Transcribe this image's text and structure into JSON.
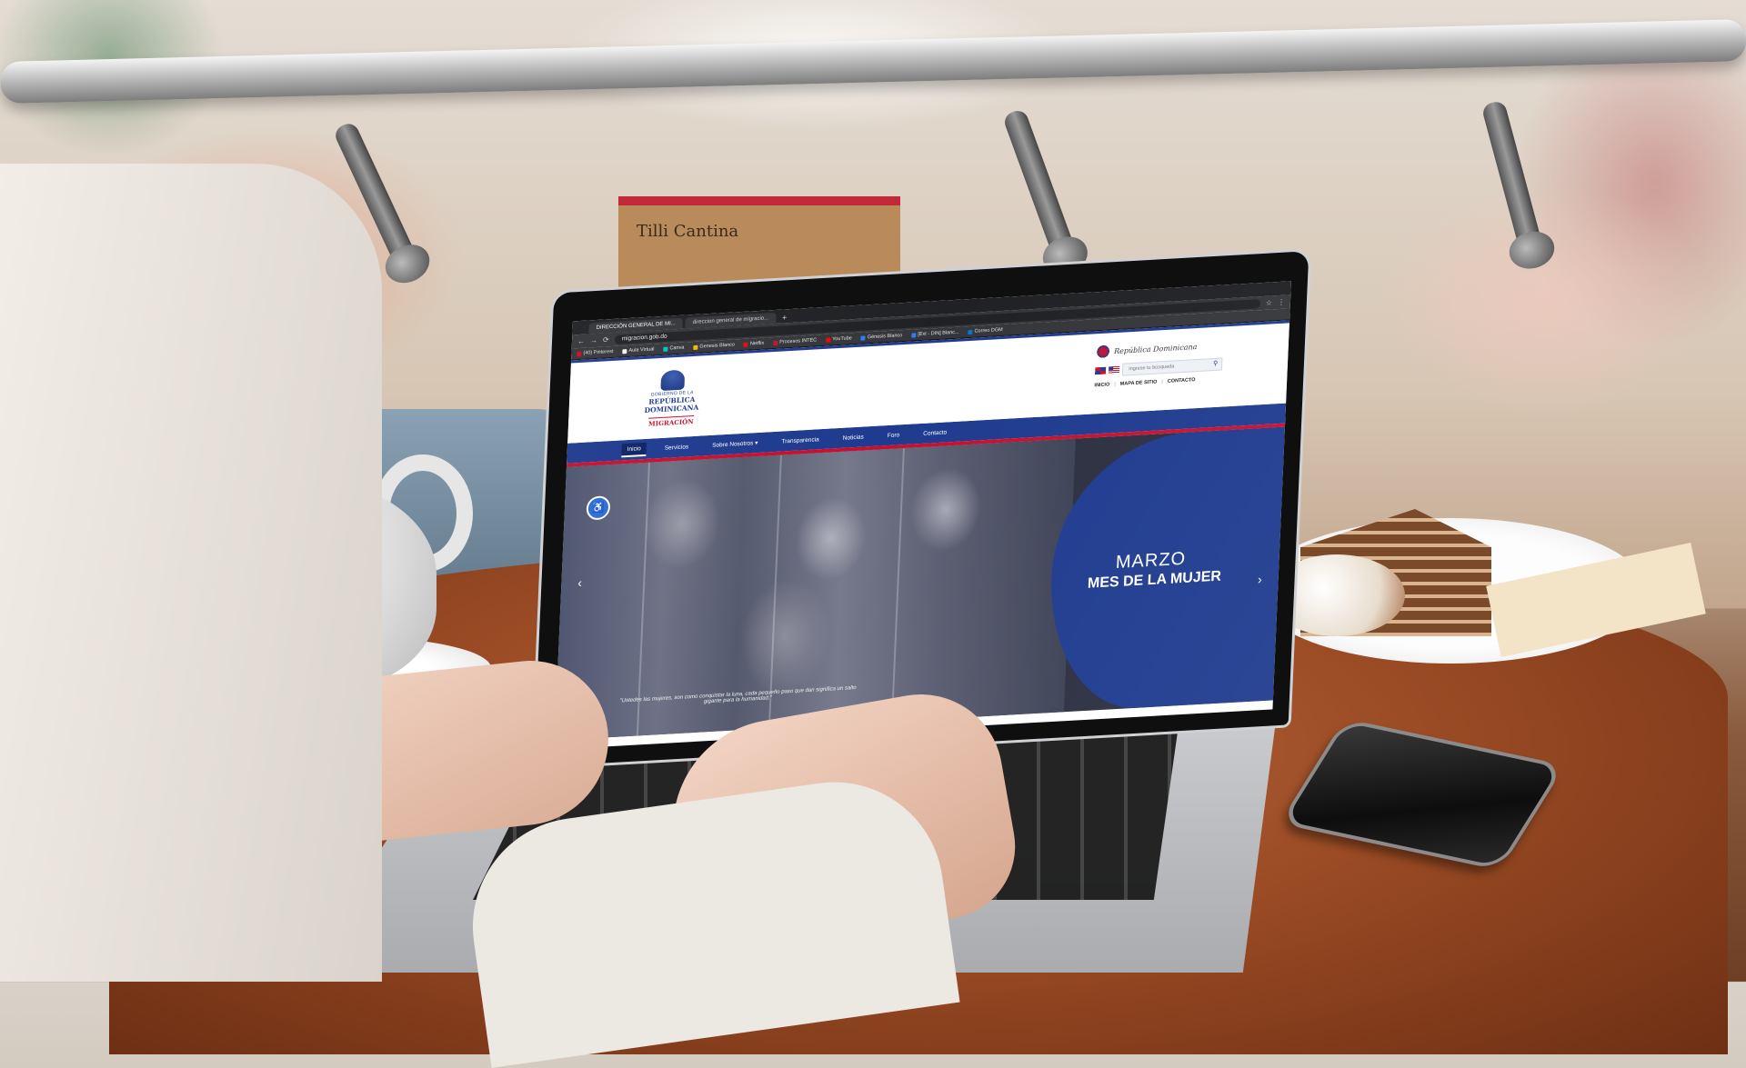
{
  "scene": {
    "sign_text": "Tilli Cantina"
  },
  "browser": {
    "tabs": [
      {
        "label": "DIRECCIÓN GENERAL DE MI...",
        "active": true
      },
      {
        "label": "direccion general de migracio...",
        "active": false
      }
    ],
    "new_tab": "+",
    "url": "migracion.gob.do",
    "nav": {
      "back": "←",
      "forward": "→",
      "reload": "⟳"
    },
    "bookmarks": [
      {
        "label": "(40) Pinterest",
        "color": "#e60023"
      },
      {
        "label": "Aula Virtual",
        "color": "#f2f2f2"
      },
      {
        "label": "Canva",
        "color": "#00c4cc"
      },
      {
        "label": "Genesis Blanco",
        "color": "#f2b705"
      },
      {
        "label": "Netflix",
        "color": "#e50914"
      },
      {
        "label": "Procesos INTEC",
        "color": "#c8102e"
      },
      {
        "label": "YouTube",
        "color": "#ff0000"
      },
      {
        "label": "Génesis Blanco",
        "color": "#2d7cf6"
      },
      {
        "label": "[Ext - DIN] Blanc...",
        "color": "#2d7cf6"
      },
      {
        "label": "Correo DGM",
        "color": "#0078d4"
      }
    ]
  },
  "site": {
    "logo": {
      "line1": "GOBIERNO DE LA",
      "line2": "REPÚBLICA DOMINICANA",
      "line3": "MIGRACIÓN"
    },
    "header_right": {
      "script_title": "República Dominicana",
      "search_placeholder": "Ingrese tu búsqueda",
      "links": [
        "INICIO",
        "MAPA DE SITIO",
        "CONTACTO"
      ],
      "separator": "|"
    },
    "nav": [
      {
        "label": "Inicio",
        "active": true
      },
      {
        "label": "Servicios",
        "active": false
      },
      {
        "label": "Sobre Nosotros ▾",
        "active": false
      },
      {
        "label": "Transparencia",
        "active": false
      },
      {
        "label": "Noticias",
        "active": false
      },
      {
        "label": "Foro",
        "active": false
      },
      {
        "label": "Contacto",
        "active": false
      }
    ],
    "hero": {
      "quote": "\"Ustedes las mujeres, son como conquistar la luna, cada pequeño paso que dan significa un salto gigante para la humanidad.\"",
      "title_line1": "MARZO",
      "title_line2": "MES DE LA MUJER",
      "prev": "‹",
      "next": "›",
      "accessibility_icon": "♿"
    }
  },
  "colors": {
    "primary_blue": "#1f3b8f",
    "accent_red": "#c8102e"
  }
}
